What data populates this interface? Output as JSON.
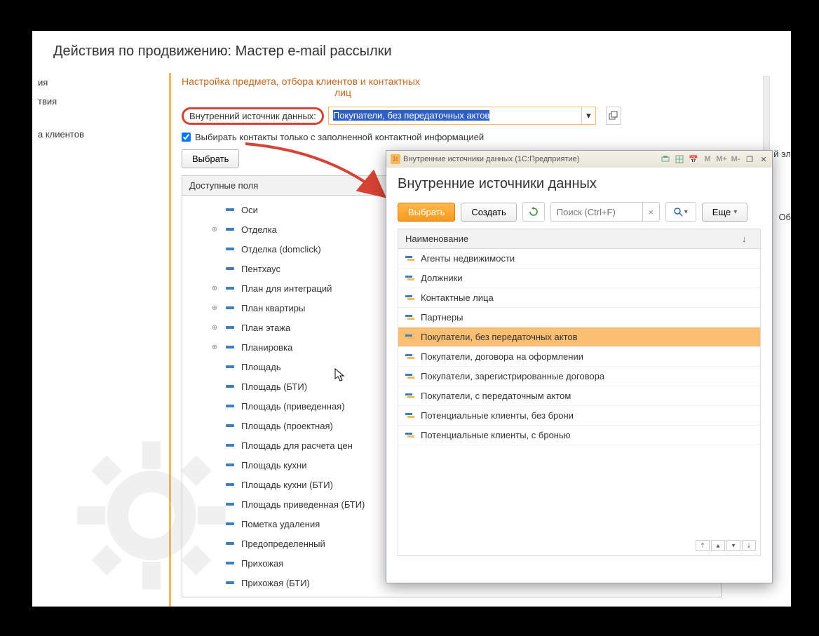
{
  "app_title": "Действия по продвижению: Мастер e-mail рассылки",
  "left_sidebar": [
    "ия",
    "твия",
    "а клиентов"
  ],
  "subtitle_l1": "Настройка предмета, отбора клиентов и контактных",
  "subtitle_l2": "лиц",
  "field_label": "Внутренний источник данных:",
  "field_value": "Покупатели, без передаточных актов",
  "checkbox_label": "Выбирать контакты только с заполненной контактной информацией",
  "checkbox_checked": true,
  "select_btn": "Выбрать",
  "tree_header": "Доступные поля",
  "tree": [
    {
      "label": "Оси",
      "expandable": false
    },
    {
      "label": "Отделка",
      "expandable": true
    },
    {
      "label": "Отделка (domclick)",
      "expandable": false
    },
    {
      "label": "Пентхаус",
      "expandable": false
    },
    {
      "label": "План для интеграций",
      "expandable": true
    },
    {
      "label": "План квартиры",
      "expandable": true
    },
    {
      "label": "План этажа",
      "expandable": true
    },
    {
      "label": "Планировка",
      "expandable": true
    },
    {
      "label": "Площадь",
      "expandable": false
    },
    {
      "label": "Площадь (БТИ)",
      "expandable": false
    },
    {
      "label": "Площадь (приведенная)",
      "expandable": false
    },
    {
      "label": "Площадь (проектная)",
      "expandable": false
    },
    {
      "label": "Площадь для расчета цен",
      "expandable": false
    },
    {
      "label": "Площадь кухни",
      "expandable": false
    },
    {
      "label": "Площадь кухни (БТИ)",
      "expandable": false
    },
    {
      "label": "Площадь приведенная (БТИ)",
      "expandable": false
    },
    {
      "label": "Пометка удаления",
      "expandable": false
    },
    {
      "label": "Предопределенный",
      "expandable": false
    },
    {
      "label": "Прихожая",
      "expandable": false
    },
    {
      "label": "Прихожая (БТИ)",
      "expandable": false
    }
  ],
  "right_truncated_1": "й эл",
  "right_truncated_2": "Об",
  "dialog": {
    "titlebar": "Внутренние источники данных  (1С:Предприятие)",
    "titlebar_icons": {
      "m": "M",
      "mp": "M+",
      "mm": "M-"
    },
    "heading": "Внутренние источники данных",
    "btn_select": "Выбрать",
    "btn_create": "Создать",
    "search_placeholder": "Поиск (Ctrl+F)",
    "btn_more": "Еще",
    "list_col": "Наименование",
    "items": [
      "Агенты недвижимости",
      "Должники",
      "Контактные лица",
      "Партнеры",
      "Покупатели, без передаточных актов",
      "Покупатели, договора на оформлении",
      "Покупатели, зарегистрированные договора",
      "Покупатели, с передаточным актом",
      "Потенциальные клиенты, без брони",
      "Потенциальные клиенты, с бронью"
    ],
    "selected_index": 4
  }
}
